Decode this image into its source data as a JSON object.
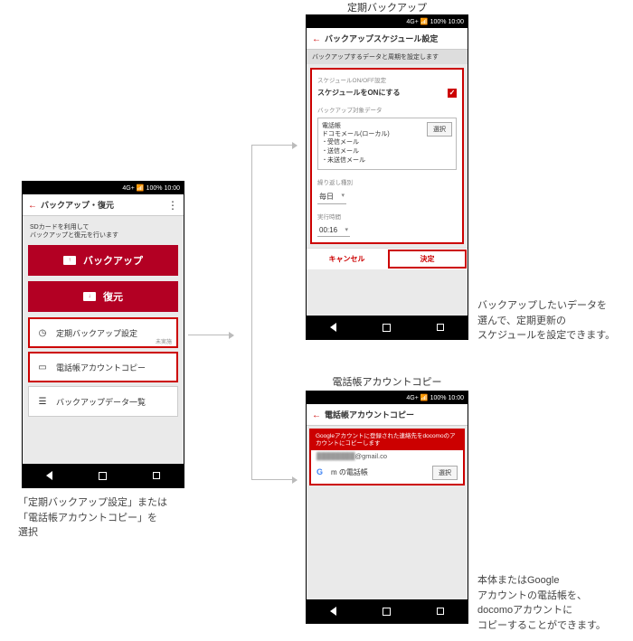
{
  "status": {
    "signal": "4G+",
    "batt": "100%",
    "time": "10:00"
  },
  "main": {
    "title": "バックアップ・復元",
    "sd_line1": "SDカードを利用して",
    "sd_line2": "バックアップと復元を行います",
    "backup": "バックアップ",
    "restore": "復元",
    "opt1": "定期バックアップ設定",
    "opt1_sub": "未実施",
    "opt2": "電話帳アカウントコピー",
    "opt3": "バックアップデータ一覧",
    "caption": "「定期バックアップ設定」または\n「電話帳アカウントコピー」を\n選択"
  },
  "sched": {
    "heading": "定期バックアップ",
    "title": "バックアップスケジュール設定",
    "info": "バックアップするデータと周期を設定します",
    "sec_onoff": "スケジュールON/OFF設定",
    "onlabel": "スケジュールをONにする",
    "sec_target": "バックアップ対象データ",
    "d_phonebook": "電話帳",
    "d_docomo": "ドコモメール(ローカル)",
    "d_recv": "受信メール",
    "d_sent": "送信メール",
    "d_unsent": "未送信メール",
    "select": "選択",
    "sec_repeat": "繰り返し種別",
    "repeat_val": "毎日",
    "sec_time": "実行時間",
    "time_val": "00:16",
    "cancel": "キャンセル",
    "ok": "決定",
    "caption": "バックアップしたいデータを\n選んで、定期更新の\nスケジュールを設定できます。"
  },
  "copy": {
    "heading": "電話帳アカウントコピー",
    "title": "電話帳アカウントコピー",
    "notice": "Googleアカウントに登録された連絡先をdocomoのアカウントにコピーします",
    "email": "@gmail.co",
    "m": "m",
    "book": "の電話帳",
    "select": "選択",
    "caption": "本体またはGoogle\nアカウントの電話帳を、\ndocomoアカウントに\nコピーすることができます。"
  }
}
